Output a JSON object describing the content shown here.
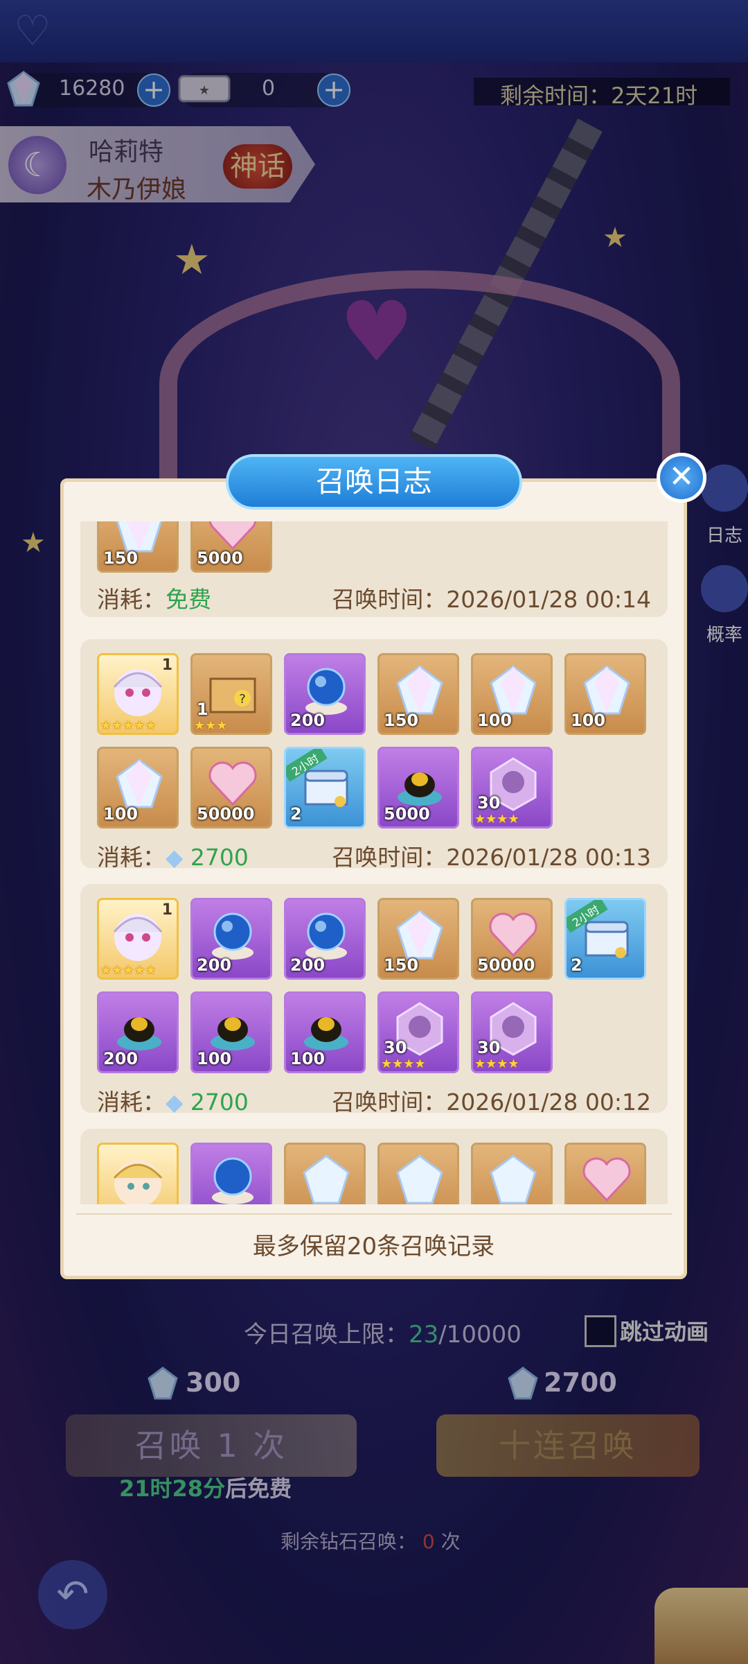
{
  "resources": {
    "diamond_count": "16280",
    "ticket_count": "0",
    "time_remaining": "剩余时间：2天21时"
  },
  "hero_banner": {
    "name": "哈莉特",
    "subtitle": "木乃伊娘",
    "rarity": "神话"
  },
  "side_buttons": {
    "log": "日志",
    "rate": "概率"
  },
  "dialog": {
    "title": "召唤日志",
    "footer": "最多保留20条召唤记录",
    "records": [
      {
        "cost_label": "消耗：",
        "cost_value": "免费",
        "time": "召唤时间：2026/01/28 00:14",
        "items": [
          {
            "type": "diamond",
            "bg": "gold",
            "qty": "150"
          },
          {
            "type": "exp-heart",
            "bg": "gold",
            "qty": "5000"
          }
        ]
      },
      {
        "cost_label": "消耗：",
        "cost_value": "2700",
        "time": "召唤时间：2026/01/28 00:13",
        "items": [
          {
            "type": "hero-portrait",
            "bg": "hero",
            "qty": "1",
            "stars": 5
          },
          {
            "type": "mystery-box",
            "bg": "gold",
            "qty": "1",
            "stars": 3
          },
          {
            "type": "crystal-orb",
            "bg": "purple",
            "qty": "200"
          },
          {
            "type": "diamond",
            "bg": "gold",
            "qty": "150"
          },
          {
            "type": "diamond",
            "bg": "gold",
            "qty": "100"
          },
          {
            "type": "diamond",
            "bg": "gold",
            "qty": "100"
          },
          {
            "type": "diamond",
            "bg": "gold",
            "qty": "100"
          },
          {
            "type": "exp-heart",
            "bg": "gold",
            "qty": "50000"
          },
          {
            "type": "treasure-chest",
            "bg": "blue",
            "qty": "2",
            "tag": "2小时"
          },
          {
            "type": "gold-egg",
            "bg": "purple",
            "qty": "5000"
          },
          {
            "type": "hero-shard",
            "bg": "purple",
            "qty": "30",
            "stars": 4
          }
        ]
      },
      {
        "cost_label": "消耗：",
        "cost_value": "2700",
        "time": "召唤时间：2026/01/28 00:12",
        "items": [
          {
            "type": "hero-portrait",
            "bg": "hero",
            "qty": "1",
            "stars": 5
          },
          {
            "type": "crystal-orb",
            "bg": "purple",
            "qty": "200"
          },
          {
            "type": "crystal-orb",
            "bg": "purple",
            "qty": "200"
          },
          {
            "type": "diamond",
            "bg": "gold",
            "qty": "150"
          },
          {
            "type": "exp-heart",
            "bg": "gold",
            "qty": "50000"
          },
          {
            "type": "treasure-chest",
            "bg": "blue",
            "qty": "2",
            "tag": "2小时"
          },
          {
            "type": "gold-egg",
            "bg": "purple",
            "qty": "200"
          },
          {
            "type": "gold-egg",
            "bg": "purple",
            "qty": "100"
          },
          {
            "type": "gold-egg",
            "bg": "purple",
            "qty": "100"
          },
          {
            "type": "hero-shard",
            "bg": "purple",
            "qty": "30",
            "stars": 4
          },
          {
            "type": "hero-shard",
            "bg": "purple",
            "qty": "30",
            "stars": 4
          }
        ]
      },
      {
        "items": [
          {
            "type": "hero-portrait-blonde",
            "bg": "hero",
            "qty": ""
          },
          {
            "type": "crystal-orb",
            "bg": "purple",
            "qty": ""
          },
          {
            "type": "diamond",
            "bg": "gold",
            "qty": ""
          },
          {
            "type": "diamond",
            "bg": "gold",
            "qty": ""
          },
          {
            "type": "diamond",
            "bg": "gold",
            "qty": ""
          },
          {
            "type": "exp-heart",
            "bg": "gold",
            "qty": ""
          }
        ]
      }
    ]
  },
  "bottom": {
    "limit_label": "今日召唤上限：",
    "limit_used": "23",
    "limit_total": "/10000",
    "skip_animation": "跳过动画",
    "single_cost": "300",
    "ten_cost": "2700",
    "single_button": "召唤 1 次",
    "ten_button": "十连召唤",
    "free_time": "21时28分",
    "free_suffix": "后免费",
    "remain_label": "剩余钻石召唤：",
    "remain_count": "0",
    "remain_unit": "次"
  },
  "colors": {
    "accent_blue": "#1e7ed6",
    "cost_green": "#2fa34e",
    "text_brown": "#6b4a2e"
  }
}
